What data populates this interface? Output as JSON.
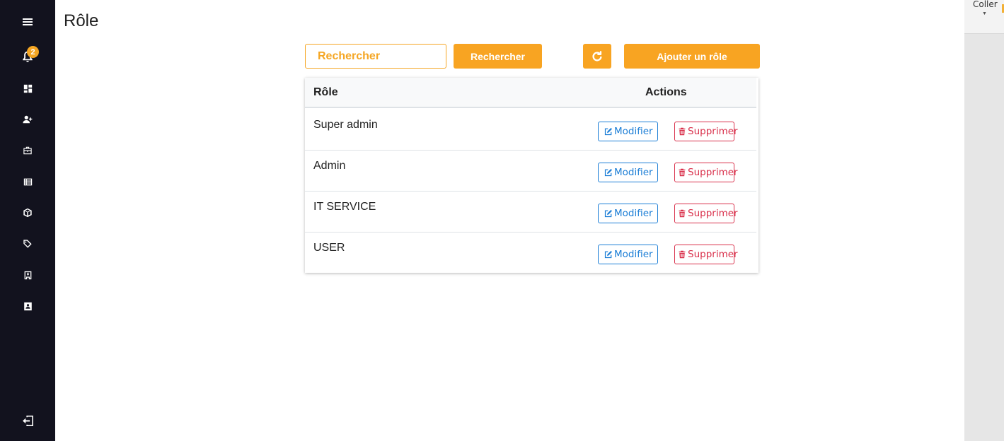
{
  "sidebar": {
    "notification_count": "2",
    "items": [
      {
        "icon": "menu-icon"
      },
      {
        "icon": "bell-icon"
      },
      {
        "icon": "dashboard-icon"
      },
      {
        "icon": "user-add-icon"
      },
      {
        "icon": "briefcase-icon"
      },
      {
        "icon": "list-icon"
      },
      {
        "icon": "box-icon"
      },
      {
        "icon": "tag-icon"
      },
      {
        "icon": "building-icon"
      },
      {
        "icon": "contact-card-icon"
      },
      {
        "icon": "logout-icon"
      }
    ]
  },
  "page": {
    "title": "Rôle"
  },
  "toolbar": {
    "search_placeholder": "Rechercher",
    "search_button": "Rechercher",
    "add_button": "Ajouter un rôle"
  },
  "table": {
    "headers": {
      "role": "Rôle",
      "actions": "Actions"
    },
    "rows": [
      {
        "role": "Super admin",
        "edit": "Modifier",
        "delete": "Supprimer"
      },
      {
        "role": "Admin",
        "edit": "Modifier",
        "delete": "Supprimer"
      },
      {
        "role": "IT SERVICE",
        "edit": "Modifier",
        "delete": "Supprimer"
      },
      {
        "role": "USER",
        "edit": "Modifier",
        "delete": "Supprimer"
      }
    ]
  },
  "right_panel": {
    "paste_label": "Coller"
  },
  "colors": {
    "accent": "#f8a422",
    "sidebar": "#12121e",
    "edit": "#1c7ed6",
    "delete": "#d9304b"
  }
}
